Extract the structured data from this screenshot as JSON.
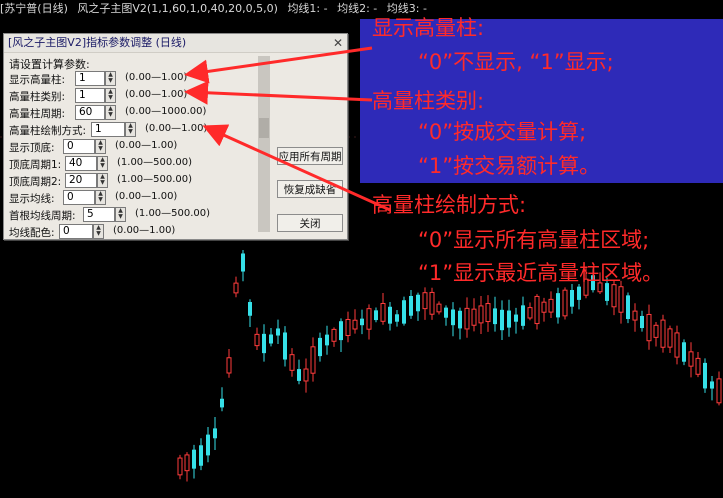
{
  "topbar": {
    "stock": "[苏宁普(日线)",
    "indicator": "风之子主图V2(1,1,60,1,0,40,20,0,5,0)",
    "ma1": "均线1: -",
    "ma2": "均线2: -",
    "ma3": "均线3: -"
  },
  "dialog": {
    "title": "[风之子主图V2]指标参数调整 (日线)",
    "prompt": "请设置计算参数:",
    "params": [
      {
        "label": "显示高量柱:",
        "value": "1",
        "range": "(0.00—1.00)"
      },
      {
        "label": "高量柱类别:",
        "value": "1",
        "range": "(0.00—1.00)"
      },
      {
        "label": "高量柱周期:",
        "value": "60",
        "range": "(0.00—1000.00)"
      },
      {
        "label": "高量柱绘制方式:",
        "value": "1",
        "range": "(0.00—1.00)"
      },
      {
        "label": "显示顶底:",
        "value": "0",
        "range": "(0.00—1.00)"
      },
      {
        "label": "顶底周期1:",
        "value": "40",
        "range": "(1.00—500.00)"
      },
      {
        "label": "顶底周期2:",
        "value": "20",
        "range": "(1.00—500.00)"
      },
      {
        "label": "显示均线:",
        "value": "0",
        "range": "(0.00—1.00)"
      },
      {
        "label": "首根均线周期:",
        "value": "5",
        "range": "(1.00—500.00)"
      },
      {
        "label": "均线配色:",
        "value": "0",
        "range": "(0.00—1.00)"
      }
    ],
    "buttons": {
      "apply_all": "应用所有周期",
      "restore": "恢复成缺省",
      "close": "关闭"
    }
  },
  "annotations": {
    "h1": "显示高量柱:",
    "h1_l1": "“0”不显示, “1”显示;",
    "h2": "高量柱类别:",
    "h2_l1": "“0”按成交量计算;",
    "h2_l2": "“1”按交易额计算。",
    "h3": "高量柱绘制方式:",
    "h3_l1": "“0”显示所有高量柱区域;",
    "h3_l2": "“1”显示最近高量柱区域。"
  },
  "colors": {
    "up": "#ff3c3c",
    "down": "#36e0e8",
    "annotation": "#ff2a2a",
    "overlay": "#2e2ab8"
  }
}
